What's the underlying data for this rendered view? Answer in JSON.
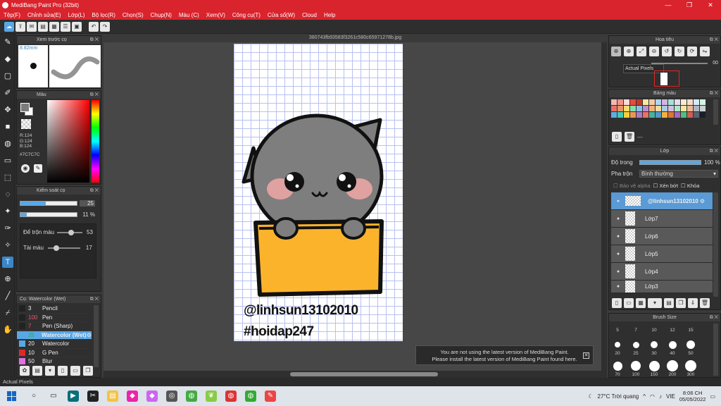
{
  "window": {
    "title": "MediBang Paint Pro (32bit)",
    "controls": [
      "—",
      "❐",
      "✕"
    ]
  },
  "menu": [
    "Tệp(F)",
    "Chỉnh sửa(E)",
    "Lớp(L)",
    "Bộ lọc(R)",
    "Chọn(S)",
    "Chụp(N)",
    "Màu (C)",
    "Xem(V)",
    "Công cụ(T)",
    "Cửa sổ(W)",
    "Cloud",
    "Help"
  ],
  "document": {
    "title": "380743fb93583f3261c580c65971278b.jpg",
    "line1": "@linhsun13102010",
    "line2": "#hoidap247"
  },
  "brush_preview": {
    "title": "Xem trước cọ",
    "size": "8.82mm"
  },
  "color": {
    "title": "Màu",
    "r": "R:124",
    "g": "G:124",
    "b": "B:124",
    "hex": "#7C7C7C",
    "current": "#7c7c7c"
  },
  "brush_control": {
    "title": "Kiểm soát cọ",
    "size_value": "25",
    "opacity_value": "11 %",
    "size_frac": 0.45,
    "opacity_frac": 0.11,
    "blend_label": "Để trộn màu",
    "blend_value": "53",
    "blend_frac": 0.53,
    "ink_label": "Tài màu",
    "ink_value": "17",
    "ink_frac": 0.17
  },
  "brush_list": {
    "title": "Cọ: Watercolor (Wet)",
    "items": [
      {
        "size": "3",
        "name": "Pencil",
        "color": "#222222"
      },
      {
        "size": "100",
        "name": "Pen",
        "color": "#222222"
      },
      {
        "size": "7",
        "name": "Pen (Sharp)",
        "color": "#222222"
      },
      {
        "size": "25",
        "name": "Watercolor (Wet)",
        "color": "#5aa7e6"
      },
      {
        "size": "20",
        "name": "Watercolor",
        "color": "#5aa7e6"
      },
      {
        "size": "10",
        "name": "G Pen",
        "color": "#e02828"
      },
      {
        "size": "50",
        "name": "Blur",
        "color": "#e070e0"
      }
    ]
  },
  "navigator": {
    "title": "Hoa tiêu",
    "zoom": "00",
    "tooltip": "Actual Pixels"
  },
  "palette": {
    "title": "Bảng màu",
    "extra": "---"
  },
  "layers": {
    "title": "Lớp",
    "opacity_label": "Độ trong",
    "opacity_value": "100 %",
    "blend_label": "Pha trộn",
    "blend_value": "Bình thường",
    "protect_alpha": "Bảo vệ alpha",
    "clipping": "Xén bớt",
    "lock": "Khóa",
    "items": [
      {
        "name": "@linhsun13102010"
      },
      {
        "name": "Lớp7"
      },
      {
        "name": "Lớp6"
      },
      {
        "name": "Lớp5"
      },
      {
        "name": "Lớp4"
      },
      {
        "name": "Lớp3"
      }
    ]
  },
  "brush_size": {
    "title": "Brush Size",
    "row1": [
      "5",
      "7",
      "10",
      "12",
      "15"
    ],
    "row2": [
      "20",
      "25",
      "30",
      "40",
      "50"
    ],
    "row3": [
      "70",
      "100",
      "150",
      "200",
      "300"
    ]
  },
  "notice": {
    "line1": "You are not using the latest version of MediBang Paint.",
    "line2": "Please install the latest version of MediBang Paint found here."
  },
  "status": "Actual Pixels",
  "taskbar": {
    "weather": "27°C  Trời quang",
    "lang": "VIE",
    "time": "8:06 CH",
    "date": "05/05/2022"
  }
}
